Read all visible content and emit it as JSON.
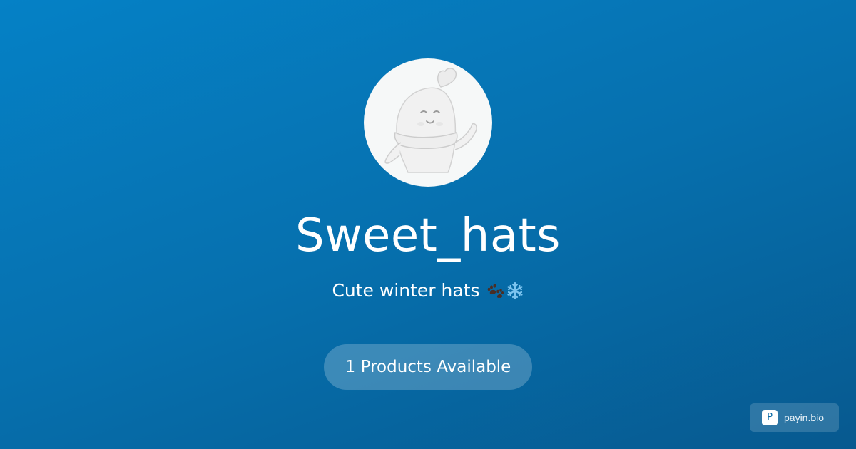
{
  "profile": {
    "name": "Sweet_hats",
    "bio": "Cute winter hats",
    "bio_emojis": [
      "paw-prints-icon",
      "snowflake-icon"
    ]
  },
  "products": {
    "label": "1 Products Available",
    "count": 1
  },
  "brand": {
    "logo_letter": "P",
    "name": "payin.bio"
  },
  "colors": {
    "background_start": "#0581c6",
    "background_end": "#07598f",
    "text": "#ffffff",
    "pill_background": "rgba(255,255,255,0.22)",
    "paw_color": "#4a2e25",
    "snowflake_color": "#7cc4ef"
  }
}
